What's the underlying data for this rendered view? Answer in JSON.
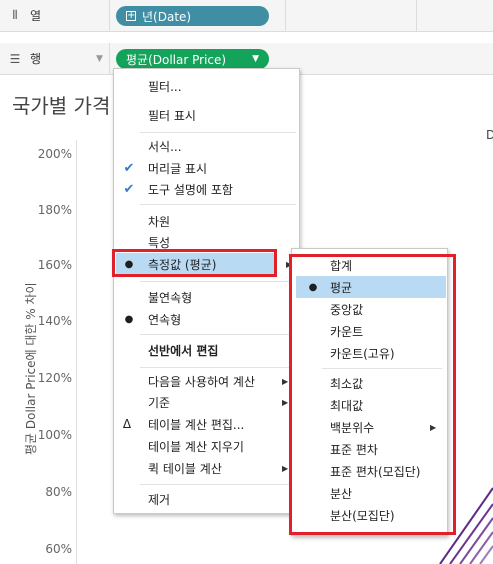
{
  "shelves": {
    "columns": {
      "icon": "columns-icon",
      "label": "열",
      "pill": "년(Date)"
    },
    "rows": {
      "icon": "rows-icon",
      "label": "행",
      "pill": "평균(Dollar Price)"
    }
  },
  "chart": {
    "title": "국가별 가격",
    "corner_text": "D",
    "y_label": "평균 Dollar Price에 대한 % 차이",
    "ticks": [
      "200%",
      "180%",
      "160%",
      "140%",
      "120%",
      "100%",
      "80%",
      "60%"
    ]
  },
  "context_menu": {
    "items": [
      {
        "label": "필터..."
      },
      {
        "label": "필터 표시"
      },
      {
        "label": "서식..."
      },
      {
        "label": "머리글 표시",
        "checked": true
      },
      {
        "label": "도구 설명에 포함",
        "checked": true
      },
      {
        "label": "차원"
      },
      {
        "label": "특성"
      },
      {
        "label": "측정값 (평균)",
        "selected": true,
        "submenu": true
      },
      {
        "label": "불연속형"
      },
      {
        "label": "연속형",
        "selected": true
      },
      {
        "label": "선반에서 편집"
      },
      {
        "label": "다음을 사용하여 계산",
        "submenu": true
      },
      {
        "label": "기준",
        "submenu": true
      },
      {
        "label": "테이블 계산 편집...",
        "mark": "Δ"
      },
      {
        "label": "테이블 계산 지우기"
      },
      {
        "label": "퀵 테이블 계산",
        "submenu": true
      },
      {
        "label": "제거"
      }
    ]
  },
  "submenu": {
    "items": [
      {
        "label": "합계"
      },
      {
        "label": "평균",
        "selected": true
      },
      {
        "label": "중앙값"
      },
      {
        "label": "카운트"
      },
      {
        "label": "카운트(고유)"
      },
      {
        "label": "최소값"
      },
      {
        "label": "최대값"
      },
      {
        "label": "백분위수",
        "submenu": true
      },
      {
        "label": "표준 편차"
      },
      {
        "label": "표준 편차(모집단)"
      },
      {
        "label": "분산"
      },
      {
        "label": "분산(모집단)"
      }
    ]
  },
  "colors": {
    "highlight": "#b9daf3",
    "annotation_red": "#e0202a",
    "pill_blue": "#3f8ea3",
    "pill_green": "#14a35a"
  }
}
